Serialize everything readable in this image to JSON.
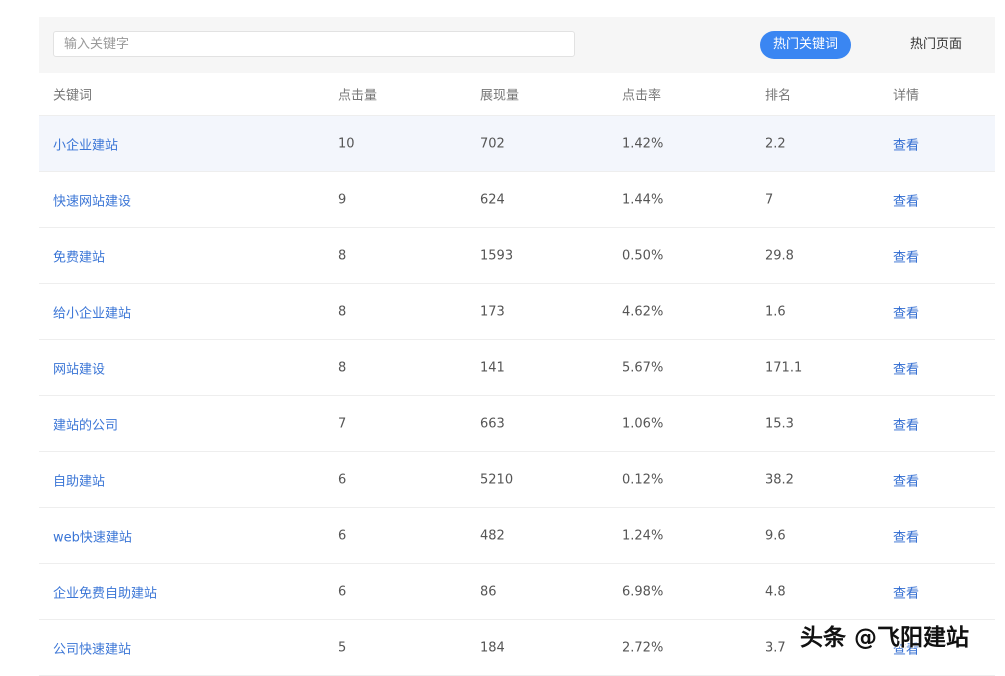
{
  "search": {
    "placeholder": "输入关键字"
  },
  "tabs": [
    {
      "label": "热门关键词",
      "active": true
    },
    {
      "label": "热门页面",
      "active": false
    }
  ],
  "columns": [
    "关键词",
    "点击量",
    "展现量",
    "点击率",
    "排名",
    "详情"
  ],
  "rows": [
    {
      "keyword": "小企业建站",
      "clicks": "10",
      "impressions": "702",
      "ctr": "1.42%",
      "rank": "2.2",
      "detail": "查看"
    },
    {
      "keyword": "快速网站建设",
      "clicks": "9",
      "impressions": "624",
      "ctr": "1.44%",
      "rank": "7",
      "detail": "查看"
    },
    {
      "keyword": "免费建站",
      "clicks": "8",
      "impressions": "1593",
      "ctr": "0.50%",
      "rank": "29.8",
      "detail": "查看"
    },
    {
      "keyword": "给小企业建站",
      "clicks": "8",
      "impressions": "173",
      "ctr": "4.62%",
      "rank": "1.6",
      "detail": "查看"
    },
    {
      "keyword": "网站建设",
      "clicks": "8",
      "impressions": "141",
      "ctr": "5.67%",
      "rank": "171.1",
      "detail": "查看"
    },
    {
      "keyword": "建站的公司",
      "clicks": "7",
      "impressions": "663",
      "ctr": "1.06%",
      "rank": "15.3",
      "detail": "查看"
    },
    {
      "keyword": "自助建站",
      "clicks": "6",
      "impressions": "5210",
      "ctr": "0.12%",
      "rank": "38.2",
      "detail": "查看"
    },
    {
      "keyword": "web快速建站",
      "clicks": "6",
      "impressions": "482",
      "ctr": "1.24%",
      "rank": "9.6",
      "detail": "查看"
    },
    {
      "keyword": "企业免费自助建站",
      "clicks": "6",
      "impressions": "86",
      "ctr": "6.98%",
      "rank": "4.8",
      "detail": "查看"
    },
    {
      "keyword": "公司快速建站",
      "clicks": "5",
      "impressions": "184",
      "ctr": "2.72%",
      "rank": "3.7",
      "detail": "查看"
    }
  ],
  "watermark": "头条 @飞阳建站",
  "colors": {
    "accent": "#3a86f2",
    "link": "#3a75d6",
    "highlight_row": "#f3f6fc"
  }
}
